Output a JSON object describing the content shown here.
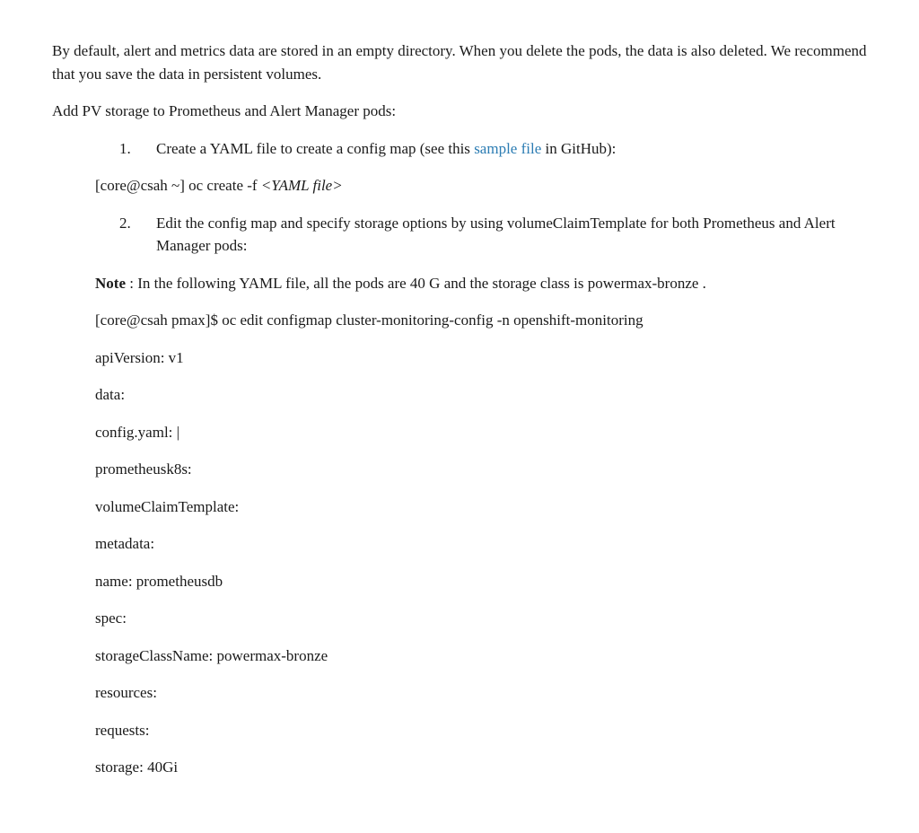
{
  "intro_paragraph": "By default, alert and metrics data are stored in an empty directory. When you delete the pods, the data is also deleted. We recommend that you save the data in persistent volumes.",
  "instruction_heading": "Add PV storage to Prometheus and Alert Manager pods:",
  "step1_prefix": "Create a YAML file to create a config map (see this ",
  "step1_link": "sample file",
  "step1_suffix": " in GitHub):",
  "cmd1_prefix": "[core@csah ~] oc create -f ",
  "cmd1_arg": "<YAML file>",
  "step2": "Edit the config map and specify storage options by using volumeClaimTemplate for both Prometheus and Alert Manager pods:",
  "note_label": "Note",
  "note_text": " : In the following YAML file, all the pods are 40 G and the storage class is powermax-bronze .",
  "cmd2": "[core@csah pmax]$ oc edit configmap cluster-monitoring-config -n openshift-monitoring",
  "yaml_lines": {
    "l0": "apiVersion: v1",
    "l1": "data:",
    "l2": "config.yaml: |",
    "l3": "prometheusk8s:",
    "l4": "volumeClaimTemplate:",
    "l5": "metadata:",
    "l6": "name: prometheusdb",
    "l7": "spec:",
    "l8": "storageClassName: powermax-bronze",
    "l9": "resources:",
    "l10": "requests:",
    "l11": "storage: 40Gi"
  }
}
